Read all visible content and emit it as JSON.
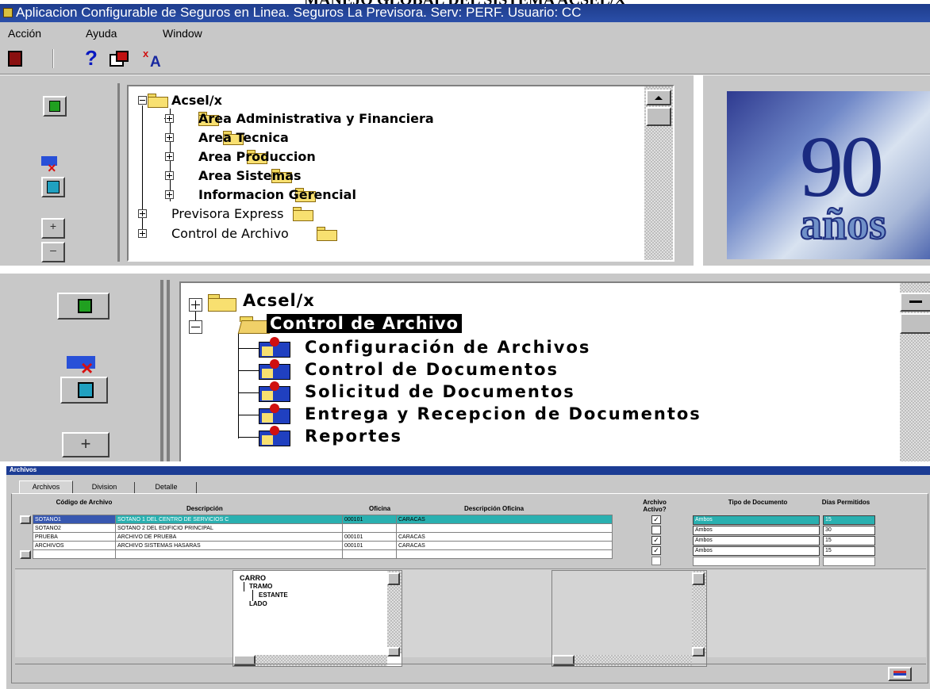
{
  "page_heading": "MANEJO GLOBAL DEL SISTEMA ACSEL/X",
  "window": {
    "title": "Aplicacion Configurable de Seguros en Linea. Seguros La Previsora. Serv: PERF. Usuario: CC",
    "menu": [
      "Acción",
      "Ayuda",
      "Window"
    ],
    "toolbar_icons": [
      "exit-door-icon",
      "help-icon",
      "translate-icon",
      "font-icon"
    ]
  },
  "top_tree": {
    "root": "Acsel/x",
    "areas": [
      "Area Administrativa y Financiera",
      "Area Tecnica",
      "Area Produccion",
      "Area Sistemas",
      "Informacion Gerencial"
    ],
    "siblings": [
      "Previsora Express",
      "Control de Archivo"
    ]
  },
  "banner": {
    "number": "90",
    "word": "años"
  },
  "middle_tree": {
    "root": "Acsel/x",
    "selected": "Control de Archivo",
    "children": [
      "Configuración de Archivos",
      "Control de Documentos",
      "Solicitud de Documentos",
      "Entrega y Recepcion de Documentos",
      "Reportes"
    ]
  },
  "form": {
    "title": "Archivos",
    "tabs": [
      "Archivos",
      "Division",
      "Detalle"
    ],
    "columns": [
      "Código de Archivo",
      "Descripción",
      "Oficina",
      "Descripción Oficina",
      "Archivo Activo?",
      "Tipo de Documento",
      "Días Permitidos"
    ],
    "rows": [
      {
        "code": "SOTANO1",
        "desc": "SOTANO 1 DEL CENTRO DE SERVICIOS C",
        "office": "000101",
        "office_desc": "CARACAS",
        "active": true,
        "doc_type": "Ambos",
        "days": "15"
      },
      {
        "code": "SOTANO2",
        "desc": "SOTANO 2 DEL EDIFICIO PRINCIPAL",
        "office": "",
        "office_desc": "",
        "active": false,
        "doc_type": "Ambos",
        "days": "30"
      },
      {
        "code": "PRUEBA",
        "desc": "ARCHIVO DE PRUEBA",
        "office": "000101",
        "office_desc": "CARACAS",
        "active": true,
        "doc_type": "Ambos",
        "days": "15"
      },
      {
        "code": "ARCHIVOS",
        "desc": "ARCHIVO SISTEMAS HASARAS",
        "office": "000101",
        "office_desc": "CARACAS",
        "active": true,
        "doc_type": "Ambos",
        "days": "15"
      }
    ],
    "subtree": [
      "CARRO",
      "TRAMO",
      "ESTANTE",
      "LADO"
    ]
  }
}
